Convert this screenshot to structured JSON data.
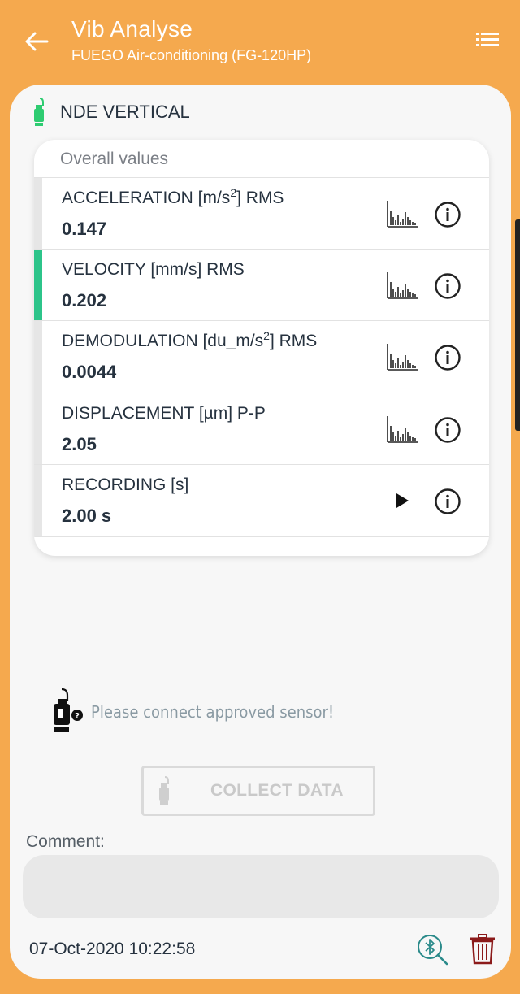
{
  "header": {
    "title": "Vib Analyse",
    "subtitle": "FUEGO Air-conditioning (FG-120HP)"
  },
  "point": {
    "title": "NDE VERTICAL"
  },
  "overall": {
    "title": "Overall values",
    "rows": [
      {
        "label_pre": "ACCELERATION [m/s",
        "sup": "2",
        "label_post": "] RMS",
        "value": "0.147",
        "action": "spectrum-icon"
      },
      {
        "label_pre": "VELOCITY [mm/s] RMS",
        "sup": "",
        "label_post": "",
        "value": "0.202",
        "action": "spectrum-icon"
      },
      {
        "label_pre": "DEMODULATION [du_m/s",
        "sup": "2",
        "label_post": "] RMS",
        "value": "0.0044",
        "action": "spectrum-icon"
      },
      {
        "label_pre": "DISPLACEMENT [µm] P-P",
        "sup": "",
        "label_post": "",
        "value": "2.05",
        "action": "spectrum-icon"
      },
      {
        "label_pre": "RECORDING [s]",
        "sup": "",
        "label_post": "",
        "value": "2.00 s",
        "action": "play-icon"
      }
    ]
  },
  "warning": {
    "text": "Please connect approved sensor!"
  },
  "collect": {
    "label": "COLLECT DATA"
  },
  "comment": {
    "label": "Comment:",
    "value": "",
    "placeholder": ""
  },
  "footer": {
    "timestamp": "07-Oct-2020 10:22:58"
  },
  "colors": {
    "background": "#F5A94E",
    "active_bar": "#2CC48A",
    "sensor_green": "#2ECC71",
    "trash": "#8B1A1A",
    "bluetooth": "#2A8A8A"
  }
}
